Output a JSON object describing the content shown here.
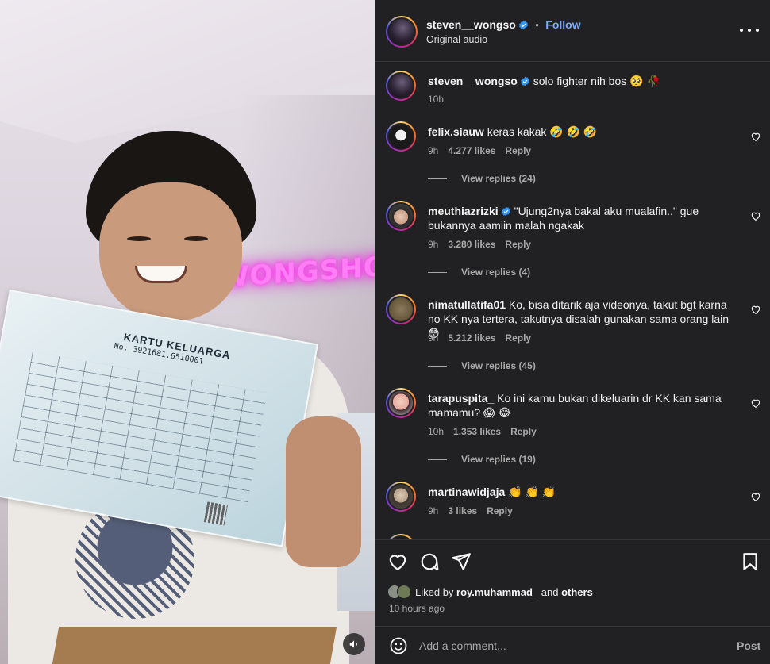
{
  "video": {
    "neon_sign": "WONGSHOW",
    "document_title": "KARTU KELUARGA",
    "document_number": "No. 3921681.6510001",
    "mute_icon": "speaker-icon"
  },
  "header": {
    "username": "steven__wongso",
    "follow_label": "Follow",
    "dot": "•",
    "subtitle": "Original audio",
    "more_icon": "more-horizontal-icon"
  },
  "caption": {
    "username": "steven__wongso",
    "text": "solo fighter nih bos 🥺 🥀",
    "time": "10h"
  },
  "comments": [
    {
      "username": "felix.siauw",
      "verified": false,
      "text": "keras kakak 🤣 🤣 🤣",
      "time": "9h",
      "likes": "4.277 likes",
      "reply": "Reply",
      "view_replies": "View replies (24)"
    },
    {
      "username": "meuthiazrizki",
      "verified": true,
      "text": "\"Ujung2nya bakal aku mualafin..\" gue bukannya aamiin malah ngakak",
      "time": "9h",
      "likes": "3.280 likes",
      "reply": "Reply",
      "view_replies": "View replies (4)"
    },
    {
      "username": "nimatullatifa01",
      "verified": false,
      "text": "Ko, bisa ditarik aja videonya, takut bgt karna no KK nya tertera, takutnya disalah gunakan sama orang lain 😳",
      "time": "9h",
      "likes": "5.212 likes",
      "reply": "Reply",
      "view_replies": "View replies (45)"
    },
    {
      "username": "tarapuspita_",
      "verified": false,
      "text": "Ko ini kamu bukan dikeluarin dr KK kan sama mamamu? 😱 😂",
      "time": "10h",
      "likes": "1.353 likes",
      "reply": "Reply",
      "view_replies": "View replies (19)"
    },
    {
      "username": "martinawidjaja",
      "verified": false,
      "text": "👏 👏 👏",
      "time": "9h",
      "likes": "3 likes",
      "reply": "Reply",
      "view_replies": ""
    }
  ],
  "actions": {
    "liked_by_prefix": "Liked by",
    "liked_by_user": "roy.muhammad_",
    "liked_by_and": "and",
    "liked_by_others": "others",
    "time_ago": "10 hours ago"
  },
  "composer": {
    "placeholder": "Add a comment...",
    "post_label": "Post"
  },
  "colors": {
    "background": "#212123",
    "link_blue": "#7aa8ff",
    "muted_text": "#a8a8a8",
    "neon_pink": "#ff7ef5"
  }
}
